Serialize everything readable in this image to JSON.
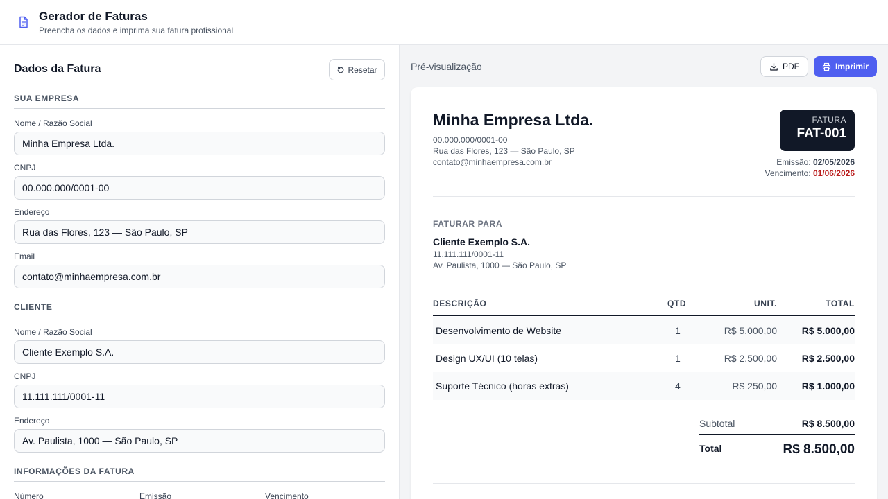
{
  "header": {
    "icon": "document-icon",
    "title": "Gerador de Faturas",
    "subtitle": "Preencha os dados e imprima sua fatura profissional"
  },
  "form": {
    "title": "Dados da Fatura",
    "reset_label": "Resetar",
    "company_section": "SUA EMPRESA",
    "company_fields": [
      {
        "label": "Nome / Razão Social",
        "value": "Minha Empresa Ltda."
      },
      {
        "label": "CNPJ",
        "value": "00.000.000/0001-00"
      },
      {
        "label": "Endereço",
        "value": "Rua das Flores, 123 — São Paulo, SP"
      },
      {
        "label": "Email",
        "value": "contato@minhaempresa.com.br"
      }
    ],
    "client_section": "CLIENTE",
    "client_fields": [
      {
        "label": "Nome / Razão Social",
        "value": "Cliente Exemplo S.A."
      },
      {
        "label": "CNPJ",
        "value": "11.111.111/0001-11"
      },
      {
        "label": "Endereço",
        "value": "Av. Paulista, 1000 — São Paulo, SP"
      }
    ],
    "invoice_section": "INFORMAÇÕES DA FATURA",
    "invoice_labels": [
      "Número",
      "Emissão",
      "Vencimento"
    ]
  },
  "preview": {
    "label": "Pré-visualização",
    "pdf_label": "PDF",
    "print_label": "Imprimir",
    "accent_color": "#4f5ff0"
  },
  "invoice": {
    "company_name": "Minha Empresa Ltda.",
    "company_cnpj": "00.000.000/0001-00",
    "company_address": "Rua das Flores, 123 — São Paulo, SP",
    "company_email": "contato@minhaempresa.com.br",
    "badge_label": "FATURA",
    "number": "FAT-001",
    "issue_label": "Emissão:",
    "issue_date": "02/05/2026",
    "due_label": "Vencimento:",
    "due_date": "01/06/2026",
    "bill_to_label": "FATURAR PARA",
    "client_name": "Cliente Exemplo S.A.",
    "client_cnpj": "11.111.111/0001-11",
    "client_address": "Av. Paulista, 1000 — São Paulo, SP",
    "columns": {
      "desc": "DESCRIÇÃO",
      "qty": "QTD",
      "unit": "UNIT.",
      "total": "TOTAL"
    },
    "items": [
      {
        "desc": "Desenvolvimento de Website",
        "qty": "1",
        "unit": "R$ 5.000,00",
        "total": "R$ 5.000,00"
      },
      {
        "desc": "Design UX/UI (10 telas)",
        "qty": "1",
        "unit": "R$ 2.500,00",
        "total": "R$ 2.500,00"
      },
      {
        "desc": "Suporte Técnico (horas extras)",
        "qty": "4",
        "unit": "R$ 250,00",
        "total": "R$ 1.000,00"
      }
    ],
    "subtotal_label": "Subtotal",
    "subtotal": "R$ 8.500,00",
    "total_label": "Total",
    "total": "R$ 8.500,00"
  }
}
